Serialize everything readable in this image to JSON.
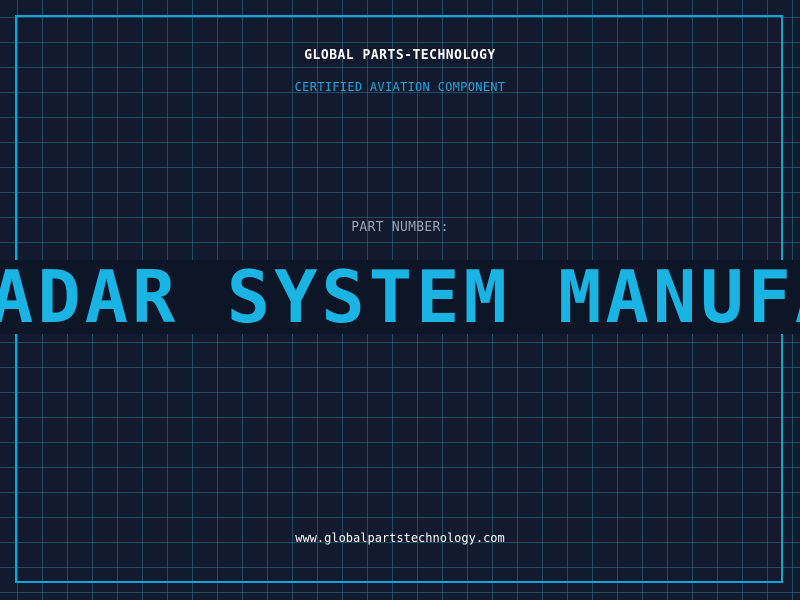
{
  "header": {
    "company": "GLOBAL PARTS-TECHNOLOGY",
    "subtitle": "CERTIFIED AVIATION COMPONENT"
  },
  "part": {
    "label": "PART NUMBER:",
    "value": "ADAR SYSTEM MANUFA"
  },
  "footer": {
    "url": "www.globalpartstechnology.com"
  },
  "colors": {
    "background": "#111a2e",
    "grid": "#3884a0",
    "accent": "#19b4e3",
    "label": "#9aa6b8"
  }
}
